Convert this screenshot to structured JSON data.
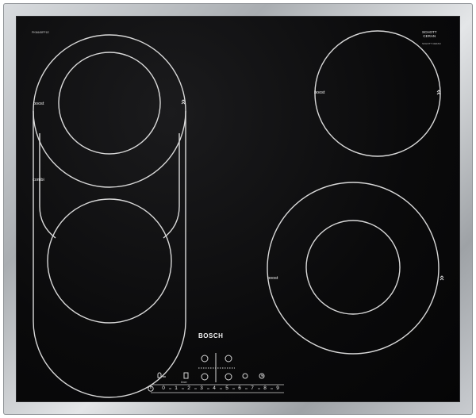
{
  "hob": {
    "model_number": "PKN645FP1E",
    "glass_brand_line1": "SCHOTT",
    "glass_brand_line2": "CERAN",
    "glass_brand_sub": "SCHOTT CERAN",
    "appliance_brand": "BOSCH"
  },
  "zones": {
    "left_top_label": "boost",
    "left_combi_label": "combi",
    "right_top_label": "boost",
    "right_bottom_label": "boost"
  },
  "controls": {
    "timer_label": "timer",
    "power_levels": [
      "0",
      "1",
      "2",
      "3",
      "4",
      "5",
      "6",
      "7",
      "8",
      "9"
    ],
    "icons": [
      "power-icon",
      "child-lock-icon",
      "keep-warm-icon",
      "zone-select-icon",
      "timer-icon",
      "boost-icon"
    ]
  },
  "colors": {
    "glass": "#0a0a0b",
    "lines": "#d8d8d8",
    "frame": "#b4b8bc"
  }
}
